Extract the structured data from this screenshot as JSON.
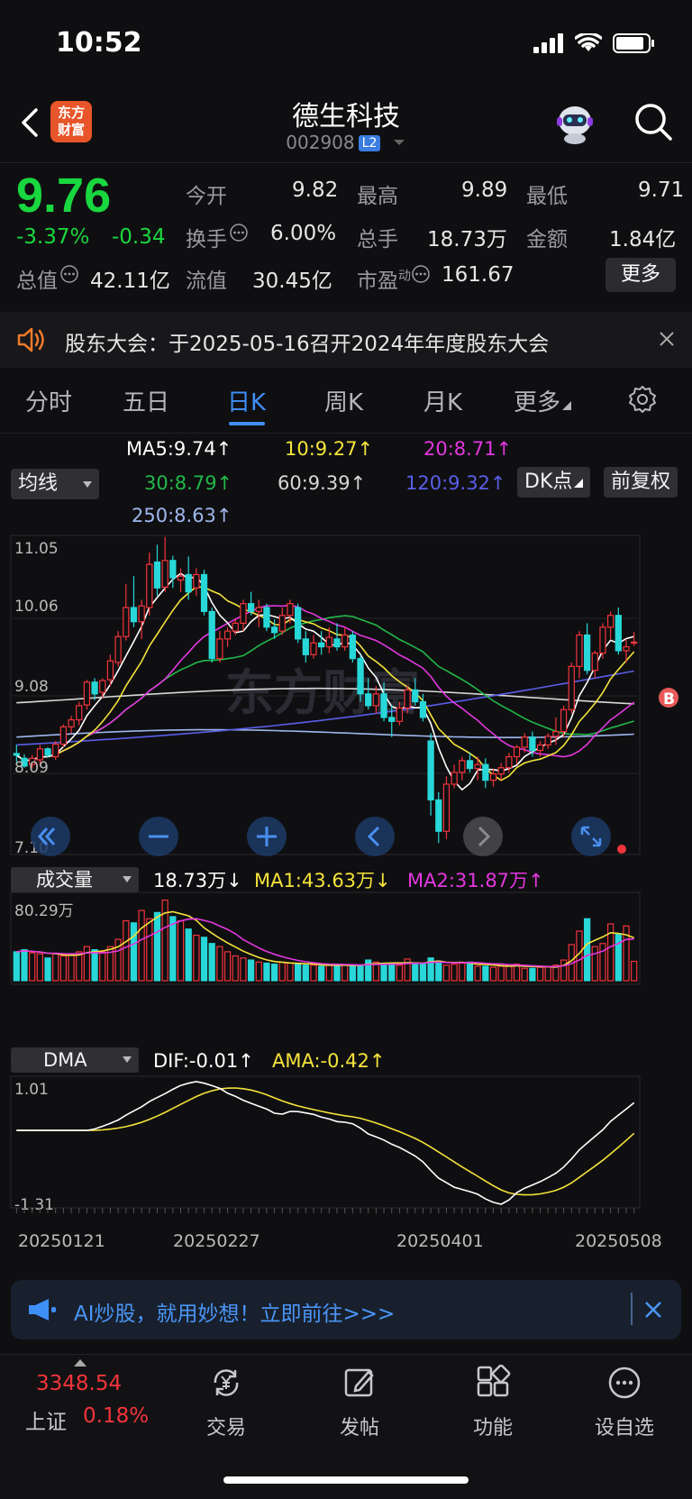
{
  "status": {
    "time": "10:52"
  },
  "header": {
    "logo_line1": "东方",
    "logo_line2": "财富",
    "name": "德生科技",
    "code": "002908",
    "level": "L2"
  },
  "quote": {
    "price": "9.76",
    "pct": "-3.37%",
    "chg": "-0.34",
    "open_label": "今开",
    "open": "9.82",
    "high_label": "最高",
    "high": "9.89",
    "low_label": "最低",
    "low": "9.71",
    "turnover_label": "换手",
    "turnover": "6.00%",
    "volume_label": "总手",
    "volume": "18.73万",
    "amount_label": "金额",
    "amount": "1.84亿",
    "mktcap_label": "总值",
    "mktcap": "42.11亿",
    "float_label": "流值",
    "float": "30.45亿",
    "pe_label": "市盈",
    "pe_sup": "动",
    "pe": "161.67",
    "more": "更多"
  },
  "notice": {
    "text": "股东大会：于2025-05-16召开2024年年度股东大会"
  },
  "tabs": [
    {
      "label": "分时"
    },
    {
      "label": "五日"
    },
    {
      "label": "日K"
    },
    {
      "label": "周K"
    },
    {
      "label": "月K"
    },
    {
      "label": "更多"
    }
  ],
  "ma": {
    "selector": "均线",
    "ma5": "MA5:9.74↑",
    "ma10": "10:9.27↑",
    "ma20": "20:8.71↑",
    "ma30": "30:8.79↑",
    "ma60": "60:9.39↑",
    "ma120": "120:9.32↑",
    "ma250": "250:8.63↑",
    "dk": "DK点",
    "fq": "前复权",
    "colors": {
      "ma5": "#ffffff",
      "ma10": "#f5e33b",
      "ma20": "#e437e0",
      "ma30": "#22b84a",
      "ma60": "#d8d8d8",
      "ma120": "#5a5ee8",
      "ma250": "#9fb7ee"
    }
  },
  "chart_data": [
    {
      "type": "candlestick",
      "y_ticks": [
        "11.05",
        "10.06",
        "9.08",
        "8.09",
        "7.10"
      ],
      "ylim": [
        7.1,
        11.05
      ],
      "candles": [
        [
          8.34,
          8.45,
          8.23,
          8.32
        ],
        [
          8.28,
          8.33,
          8.16,
          8.18
        ],
        [
          8.2,
          8.32,
          8.15,
          8.28
        ],
        [
          8.26,
          8.45,
          8.2,
          8.4
        ],
        [
          8.4,
          8.42,
          8.29,
          8.32
        ],
        [
          8.3,
          8.5,
          8.26,
          8.46
        ],
        [
          8.46,
          8.71,
          8.42,
          8.68
        ],
        [
          8.68,
          8.82,
          8.6,
          8.77
        ],
        [
          8.77,
          9.0,
          8.7,
          8.95
        ],
        [
          8.96,
          9.28,
          8.9,
          9.25
        ],
        [
          9.25,
          9.3,
          9.02,
          9.1
        ],
        [
          9.12,
          9.3,
          9.05,
          9.27
        ],
        [
          9.28,
          9.6,
          9.2,
          9.52
        ],
        [
          9.5,
          9.9,
          9.45,
          9.83
        ],
        [
          9.83,
          10.5,
          9.78,
          10.2
        ],
        [
          10.2,
          10.6,
          9.95,
          10.02
        ],
        [
          10.02,
          10.3,
          9.8,
          10.22
        ],
        [
          10.2,
          10.9,
          10.1,
          10.75
        ],
        [
          10.78,
          11.0,
          10.35,
          10.45
        ],
        [
          10.46,
          11.1,
          10.4,
          10.8
        ],
        [
          10.8,
          10.86,
          10.45,
          10.58
        ],
        [
          10.55,
          10.7,
          10.4,
          10.6
        ],
        [
          10.62,
          10.85,
          10.3,
          10.4
        ],
        [
          10.45,
          10.7,
          10.35,
          10.62
        ],
        [
          10.62,
          10.68,
          10.1,
          10.15
        ],
        [
          10.15,
          10.2,
          9.5,
          9.55
        ],
        [
          9.55,
          9.9,
          9.5,
          9.8
        ],
        [
          9.8,
          9.95,
          9.7,
          9.9
        ],
        [
          9.9,
          10.05,
          9.85,
          10.0
        ],
        [
          10.0,
          10.3,
          9.9,
          10.25
        ],
        [
          10.25,
          10.4,
          10.1,
          10.15
        ],
        [
          10.15,
          10.3,
          9.95,
          10.2
        ],
        [
          10.2,
          10.25,
          9.9,
          9.95
        ],
        [
          9.95,
          10.05,
          9.8,
          9.88
        ],
        [
          9.9,
          10.2,
          9.85,
          10.1
        ],
        [
          10.1,
          10.3,
          10.0,
          10.25
        ],
        [
          10.2,
          10.25,
          9.75,
          9.8
        ],
        [
          9.8,
          9.9,
          9.5,
          9.6
        ],
        [
          9.6,
          9.85,
          9.55,
          9.75
        ],
        [
          9.75,
          9.9,
          9.6,
          9.7
        ],
        [
          9.7,
          9.95,
          9.62,
          9.82
        ],
        [
          9.8,
          10.0,
          9.65,
          9.7
        ],
        [
          9.7,
          9.95,
          9.65,
          9.85
        ],
        [
          9.85,
          9.9,
          9.5,
          9.55
        ],
        [
          9.55,
          9.6,
          9.0,
          9.1
        ],
        [
          9.1,
          9.3,
          8.9,
          8.95
        ],
        [
          8.95,
          9.2,
          8.85,
          9.1
        ],
        [
          9.1,
          9.25,
          8.75,
          8.8
        ],
        [
          8.8,
          8.95,
          8.55,
          8.75
        ],
        [
          8.75,
          9.0,
          8.7,
          8.92
        ],
        [
          8.92,
          9.2,
          8.85,
          9.15
        ],
        [
          9.15,
          9.3,
          8.95,
          9.0
        ],
        [
          9.0,
          9.1,
          8.75,
          8.8
        ],
        [
          8.5,
          8.6,
          7.55,
          7.75
        ],
        [
          7.75,
          7.85,
          7.2,
          7.35
        ],
        [
          7.35,
          8.05,
          7.25,
          7.95
        ],
        [
          7.95,
          8.2,
          7.9,
          8.1
        ],
        [
          8.1,
          8.3,
          8.0,
          8.25
        ],
        [
          8.25,
          8.35,
          8.1,
          8.15
        ],
        [
          8.15,
          8.3,
          8.0,
          8.2
        ],
        [
          8.2,
          8.28,
          7.9,
          8.0
        ],
        [
          8.0,
          8.15,
          7.92,
          8.08
        ],
        [
          8.08,
          8.22,
          8.0,
          8.16
        ],
        [
          8.16,
          8.35,
          8.1,
          8.3
        ],
        [
          8.3,
          8.45,
          8.2,
          8.42
        ],
        [
          8.42,
          8.6,
          8.35,
          8.55
        ],
        [
          8.55,
          8.62,
          8.3,
          8.38
        ],
        [
          8.38,
          8.5,
          8.3,
          8.45
        ],
        [
          8.45,
          8.6,
          8.4,
          8.56
        ],
        [
          8.56,
          8.8,
          8.45,
          8.62
        ],
        [
          8.62,
          8.95,
          8.55,
          8.9
        ],
        [
          8.9,
          9.5,
          8.85,
          9.45
        ],
        [
          9.45,
          9.9,
          9.3,
          9.85
        ],
        [
          9.85,
          10.0,
          9.35,
          9.4
        ],
        [
          9.4,
          9.65,
          9.3,
          9.62
        ],
        [
          9.62,
          10.0,
          9.55,
          9.95
        ],
        [
          9.95,
          10.15,
          9.8,
          10.1
        ],
        [
          10.1,
          10.2,
          9.6,
          9.65
        ],
        [
          9.65,
          9.8,
          9.5,
          9.7
        ],
        [
          9.75,
          9.89,
          9.71,
          9.76
        ]
      ]
    },
    {
      "type": "bar",
      "title": "成交量",
      "y_ticks": [
        "80.29万"
      ],
      "ylim": [
        0,
        80.29
      ],
      "current": "18.73万↓",
      "ma1": "MA1:43.63万↓",
      "ma2": "MA2:31.87万↑",
      "values": [
        28,
        30,
        27,
        26,
        22,
        26,
        24,
        25,
        28,
        33,
        30,
        28,
        33,
        40,
        58,
        56,
        68,
        60,
        66,
        78,
        62,
        58,
        50,
        44,
        42,
        36,
        33,
        28,
        24,
        22,
        20,
        18,
        17,
        16,
        18,
        17,
        16,
        15,
        15,
        14,
        15,
        16,
        15,
        14,
        15,
        20,
        18,
        17,
        16,
        15,
        21,
        17,
        16,
        22,
        19,
        15,
        16,
        17,
        18,
        14,
        14,
        13,
        14,
        15,
        16,
        12,
        12,
        13,
        14,
        15,
        20,
        35,
        48,
        60,
        33,
        36,
        55,
        45,
        53,
        18.73
      ]
    },
    {
      "type": "line",
      "title": "DMA",
      "y_ticks": [
        "1.01",
        "-1.31"
      ],
      "ylim": [
        -1.31,
        1.01
      ],
      "dif": "DIF:-0.01↑",
      "ama": "AMA:-0.42↑",
      "x_ticks": [
        "20250121",
        "20250227",
        "20250401",
        "20250508"
      ]
    }
  ],
  "ad": {
    "text": "AI炒股，就用妙想！立即前往>>>"
  },
  "nav": {
    "index_value": "3348.54",
    "index_name": "上证",
    "index_pct": "0.18%",
    "items": [
      {
        "label": "交易"
      },
      {
        "label": "发帖"
      },
      {
        "label": "功能"
      },
      {
        "label": "设自选"
      }
    ]
  }
}
